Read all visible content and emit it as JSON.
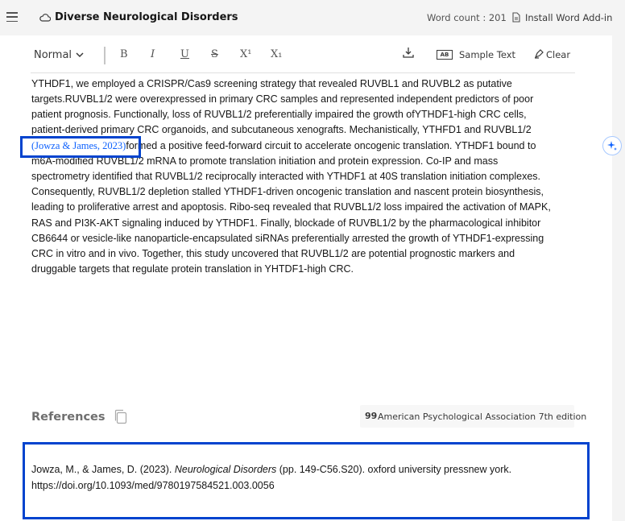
{
  "header": {
    "menu_icon": "hamburger-icon",
    "cloud_icon": "cloud-icon",
    "title": "Diverse Neurological Disorders",
    "word_count": "Word count : 201",
    "addin_icon": "word-document-icon",
    "addin_label": "Install Word Add-in"
  },
  "toolbar": {
    "style_select": "Normal",
    "bold": "B",
    "italic": "I",
    "underline": "U",
    "strikethrough": "S",
    "superscript": "X¹",
    "subscript": "X₁",
    "sample_text_badge": "AB",
    "sample_text": "Sample Text",
    "clear": "Clear"
  },
  "editor": {
    "lines": [
      "YTHDF1, we employed a CRISPR/Cas9 screening strategy that revealed RUVBL1 and RUVBL2 as putative",
      "targets.RUVBL1/2 were overexpressed in primary CRC samples and represented independent predictors of poor",
      "patient prognosis. Functionally, loss of RUVBL1/2 preferentially impaired the growth ofYTHDF1-high CRC cells,",
      "patient-derived primary CRC organoids, and subcutaneous xenografts. Mechanistically, YTHFD1 and RUVBL1/2",
      "formed a positive feed-forward circuit to accelerate oncogenic translation. YTHDF1 bound to",
      "m6A-modified RUVBL1/2 mRNA to promote translation initiation and protein expression. Co-IP and mass",
      "spectrometry identified that RUVBL1/2 reciprocally interacted with YTHDF1 at 40S translation initiation complexes.",
      "Consequently, RUVBL1/2 depletion stalled YTHDF1-driven oncogenic translation and nascent protein biosynthesis,",
      "leading to proliferative arrest and apoptosis. Ribo-seq revealed that RUVBL1/2 loss impaired the activation of MAPK,",
      "RAS and PI3K-AKT signaling induced by YTHDF1. Finally, blockade of RUVBL1/2 by the pharmacological inhibitor",
      "CB6644 or vesicle-like nanoparticle-encapsulated siRNAs preferentially arrested the growth of YTHDF1-expressing",
      "CRC in vitro and in vivo. Together, this study uncovered that RUVBL1/2 are potential prognostic markers and",
      "druggable targets that regulate protein translation in YHTDF1-high CRC."
    ],
    "inline_citation": "(Jowza & James, 2023)"
  },
  "references": {
    "title": "References",
    "copy_icon": "copy-icon",
    "style_icon": "quote-icon",
    "style_badge": "99",
    "style_label": "American Psychological Association 7th edition",
    "entry_prefix": "Jowza, M., & James, D. (2023). ",
    "entry_title": "Neurological Disorders",
    "entry_suffix": " (pp. 149-C56.S20). oxford university pressnew york.",
    "entry_doi": "https://doi.org/10.1093/med/9780197584521.003.0056"
  },
  "colors": {
    "accent": "#0043ce",
    "citation": "#0f62fe",
    "header_bg": "#f4f4f4"
  }
}
